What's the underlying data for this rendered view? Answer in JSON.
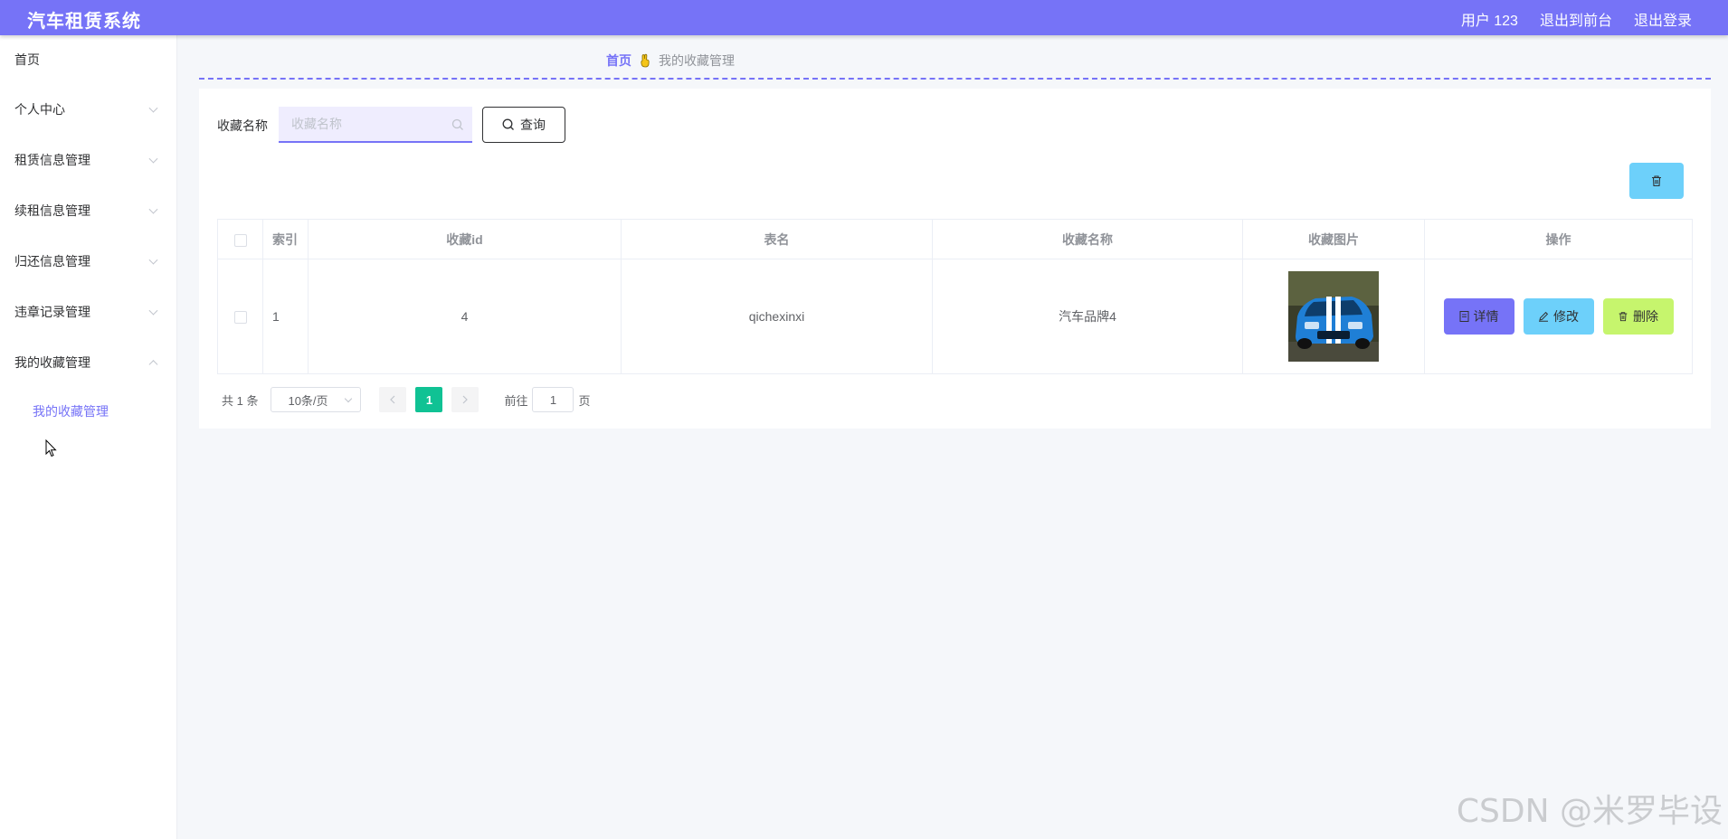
{
  "header": {
    "app_title": "汽车租赁系统",
    "user_label": "用户 123",
    "to_front_label": "退出到前台",
    "logout_label": "退出登录",
    "accent_color": "#7673f7"
  },
  "sidebar": {
    "items": [
      {
        "label": "首页"
      },
      {
        "label": "个人中心"
      },
      {
        "label": "租赁信息管理"
      },
      {
        "label": "续租信息管理"
      },
      {
        "label": "归还信息管理"
      },
      {
        "label": "违章记录管理"
      },
      {
        "label": "我的收藏管理"
      }
    ],
    "active_sub_item": "我的收藏管理"
  },
  "breadcrumb": {
    "home": "首页",
    "current": "我的收藏管理",
    "separator_icon": "hand-icon"
  },
  "search": {
    "label": "收藏名称",
    "placeholder": "收藏名称",
    "value": "",
    "query_label": "查询"
  },
  "table": {
    "headers": {
      "index": "索引",
      "fav_id": "收藏id",
      "table_name": "表名",
      "fav_name": "收藏名称",
      "fav_image": "收藏图片",
      "actions": "操作"
    },
    "rows": [
      {
        "index": "1",
        "fav_id": "4",
        "table_name": "qichexinxi",
        "fav_name": "汽车品牌4",
        "image": "blue-car-photo"
      }
    ],
    "action_labels": {
      "detail": "详情",
      "edit": "修改",
      "delete": "删除"
    },
    "action_colors": {
      "detail": "#7673f7",
      "edit": "#6dd0fa",
      "delete": "#c6f56d"
    }
  },
  "pagination": {
    "total_text": "共 1 条",
    "page_size": "10条/页",
    "current_page": "1",
    "goto_label": "前往",
    "goto_value": "1",
    "page_suffix": "页",
    "active_color": "#10c294"
  },
  "watermark": "CSDN @米罗毕设"
}
